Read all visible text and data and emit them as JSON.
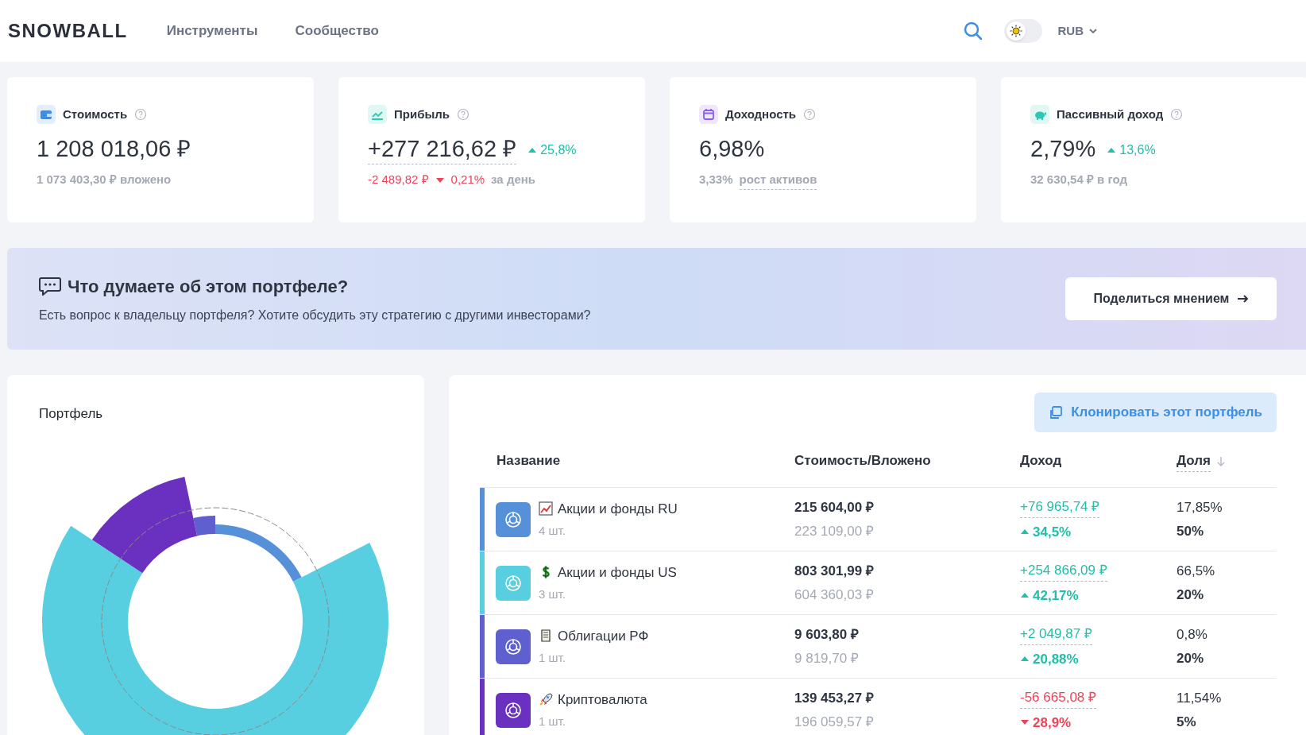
{
  "header": {
    "logo": "SNOWBALL",
    "nav": [
      "Инструменты",
      "Сообщество"
    ],
    "theme_toggle": {
      "on": false
    },
    "currency": "RUB"
  },
  "summary_cards": [
    {
      "title": "Стоимость",
      "color": "#3d8fe6",
      "value": "1 208 018,06 ₽",
      "value_underlined": false,
      "details": [
        {
          "text": "1 073 403,30 ₽ вложено",
          "negative": false,
          "underlined": false
        }
      ]
    },
    {
      "title": "Прибыль",
      "color": "#2cc7b5",
      "value": "+277 216,62 ₽",
      "value_underlined": true,
      "change": {
        "text": "25,8%",
        "rising": true
      },
      "details": [
        {
          "text": "-2 489,82 ₽",
          "negative": true,
          "underlined": false
        },
        {
          "text": "0,21%",
          "negative": true,
          "rising": false,
          "underlined": false
        },
        {
          "text": "за день",
          "negative": false,
          "underlined": false
        }
      ]
    },
    {
      "title": "Доходность",
      "color": "#8b5cf6",
      "value": "6,98%",
      "value_underlined": false,
      "details": [
        {
          "text": "3,33%",
          "negative": false,
          "underlined": false
        },
        {
          "text": "рост активов",
          "negative": false,
          "underlined": true
        }
      ]
    },
    {
      "title": "Пассивный доход",
      "color": "#2cc7b5",
      "value": "2,79%",
      "value_underlined": false,
      "change": {
        "text": "13,6%",
        "rising": true
      },
      "details": [
        {
          "text": "32 630,54 ₽ в год",
          "negative": false,
          "underlined": false
        }
      ]
    }
  ],
  "feedback_banner": {
    "title": "Что думаете об этом портфеле?",
    "text": "Есть вопрос к владельцу портфеля? Хотите обсудить эту стратегию с другими инвесторами?",
    "button": "Поделиться мнением"
  },
  "portfolio_chart": {
    "title": "Портфель"
  },
  "holdings": {
    "clone_button": "Клонировать этот портфель",
    "columns": [
      {
        "label": "Название",
        "sorted": false
      },
      {
        "label": "Стоимость/Вложено",
        "sorted": false
      },
      {
        "label": "Доход",
        "sorted": false
      },
      {
        "label": "Доля",
        "sorted": true
      }
    ],
    "rows": [
      {
        "name": "Акции и фонды RU",
        "count": "4 шт.",
        "color": "#5590d9",
        "value": "215 604,00 ₽",
        "invested": "223 109,00 ₽",
        "income": "+76 965,74 ₽",
        "income_pct": "34,5%",
        "rising": true,
        "share": "17,85%",
        "target": "50%"
      },
      {
        "name": "Акции и фонды US",
        "count": "3 шт.",
        "color": "#57cfe0",
        "value": "803 301,99 ₽",
        "invested": "604 360,03 ₽",
        "income": "+254 866,09 ₽",
        "income_pct": "42,17%",
        "rising": true,
        "share": "66,5%",
        "target": "20%"
      },
      {
        "name": "Облигации РФ",
        "count": "1 шт.",
        "color": "#5f5fcf",
        "value": "9 603,80 ₽",
        "invested": "9 819,70 ₽",
        "income": "+2 049,87 ₽",
        "income_pct": "20,88%",
        "rising": true,
        "share": "0,8%",
        "target": "20%"
      },
      {
        "name": "Криптовалюта",
        "count": "1 шт.",
        "color": "#6a30c0",
        "value": "139 453,27 ₽",
        "invested": "196 059,57 ₽",
        "income": "-56 665,08 ₽",
        "income_pct": "28,9%",
        "rising": false,
        "share": "11,54%",
        "target": "5%"
      }
    ]
  }
}
